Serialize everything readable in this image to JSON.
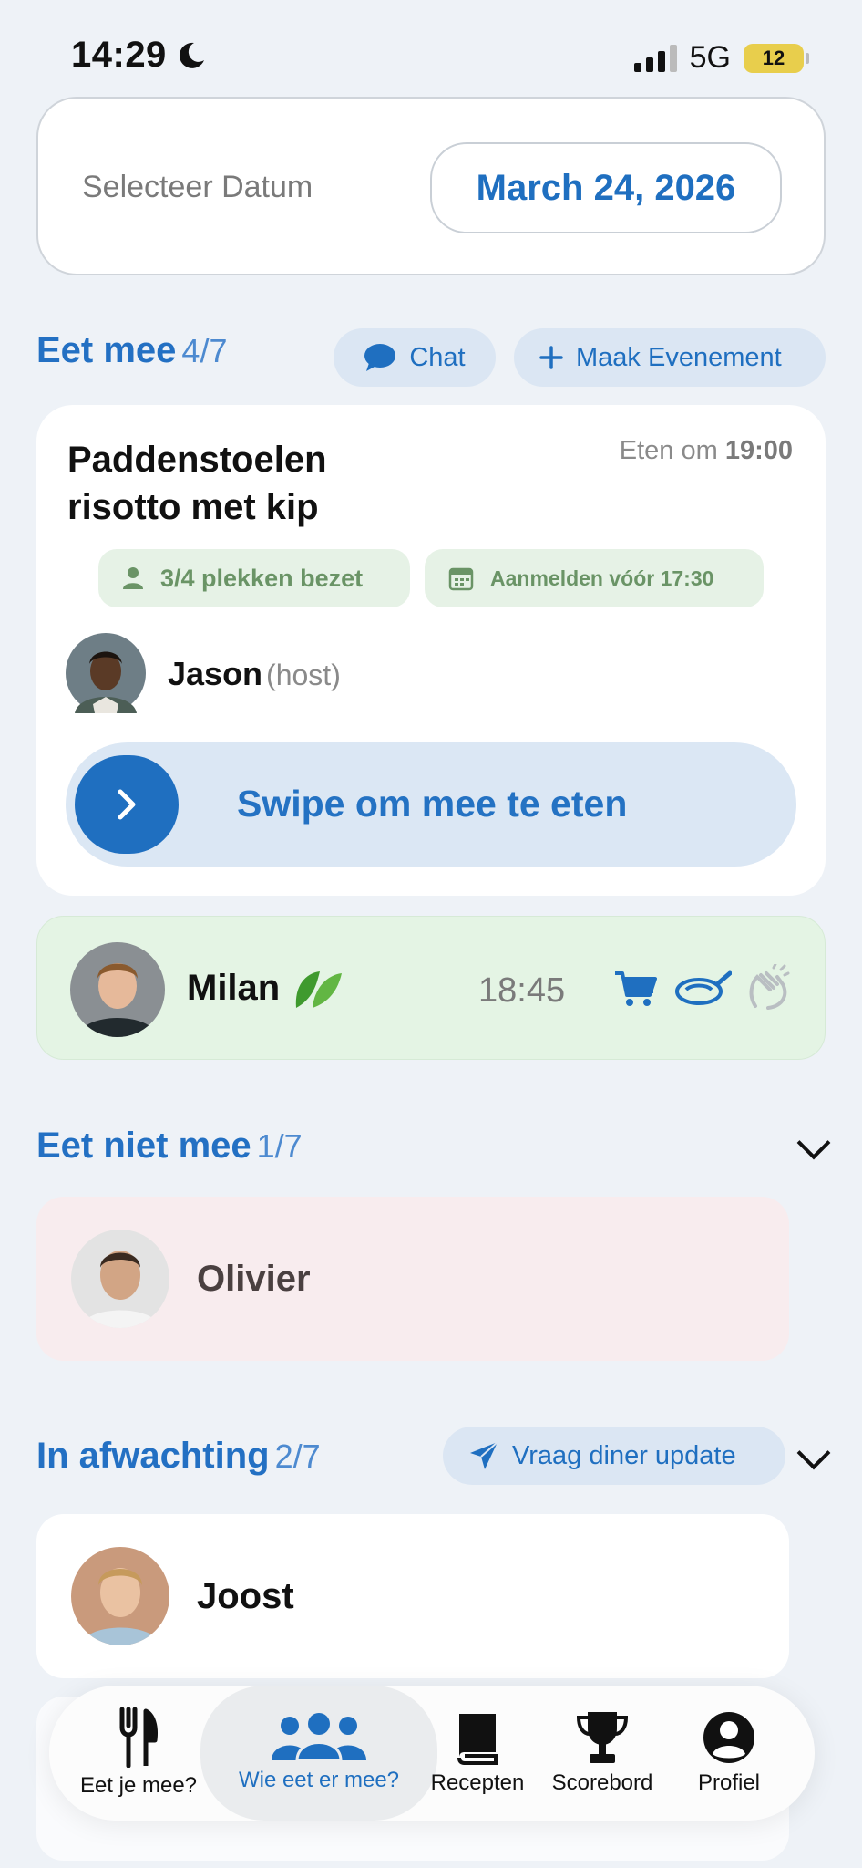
{
  "status_bar": {
    "time": "14:29",
    "network": "5G",
    "battery": "12"
  },
  "date_picker": {
    "label": "Selecteer Datum",
    "value": "March 24, 2026"
  },
  "eet_mee": {
    "title": "Eet mee",
    "count": "4/7",
    "chat_label": "Chat",
    "create_event_label": "Maak Evenement"
  },
  "event": {
    "title": "Paddenstoelen risotto met kip",
    "eat_time_prefix": "Eten om",
    "eat_time": "19:00",
    "spots": "3/4 plekken bezet",
    "signup_deadline": "Aanmelden vóór 17:30",
    "host_name": "Jason",
    "host_tag": "(host)",
    "swipe_label": "Swipe om mee te eten"
  },
  "attendees": [
    {
      "name": "Milan",
      "time": "18:45",
      "icons": [
        "leaf-icon",
        "cart-icon",
        "pan-icon",
        "clap-icon"
      ]
    }
  ],
  "eet_niet_mee": {
    "title": "Eet niet mee",
    "count": "1/7",
    "people": [
      {
        "name": "Olivier"
      }
    ]
  },
  "in_afwachting": {
    "title": "In afwachting",
    "count": "2/7",
    "update_label": "Vraag diner update",
    "people": [
      {
        "name": "Joost"
      }
    ]
  },
  "tabbar": {
    "items": [
      {
        "label": "Eet je mee?",
        "icon": "fork-knife-icon"
      },
      {
        "label": "Wie eet er mee?",
        "icon": "group-icon",
        "active": true
      },
      {
        "label": "Recepten",
        "icon": "book-icon"
      },
      {
        "label": "Scorebord",
        "icon": "trophy-icon"
      },
      {
        "label": "Profiel",
        "icon": "profile-icon"
      }
    ]
  },
  "colors": {
    "accent": "#1f6fc0",
    "background": "#eef2f7",
    "green_row": "#e4f4e4",
    "red_row": "#f8ecee"
  }
}
